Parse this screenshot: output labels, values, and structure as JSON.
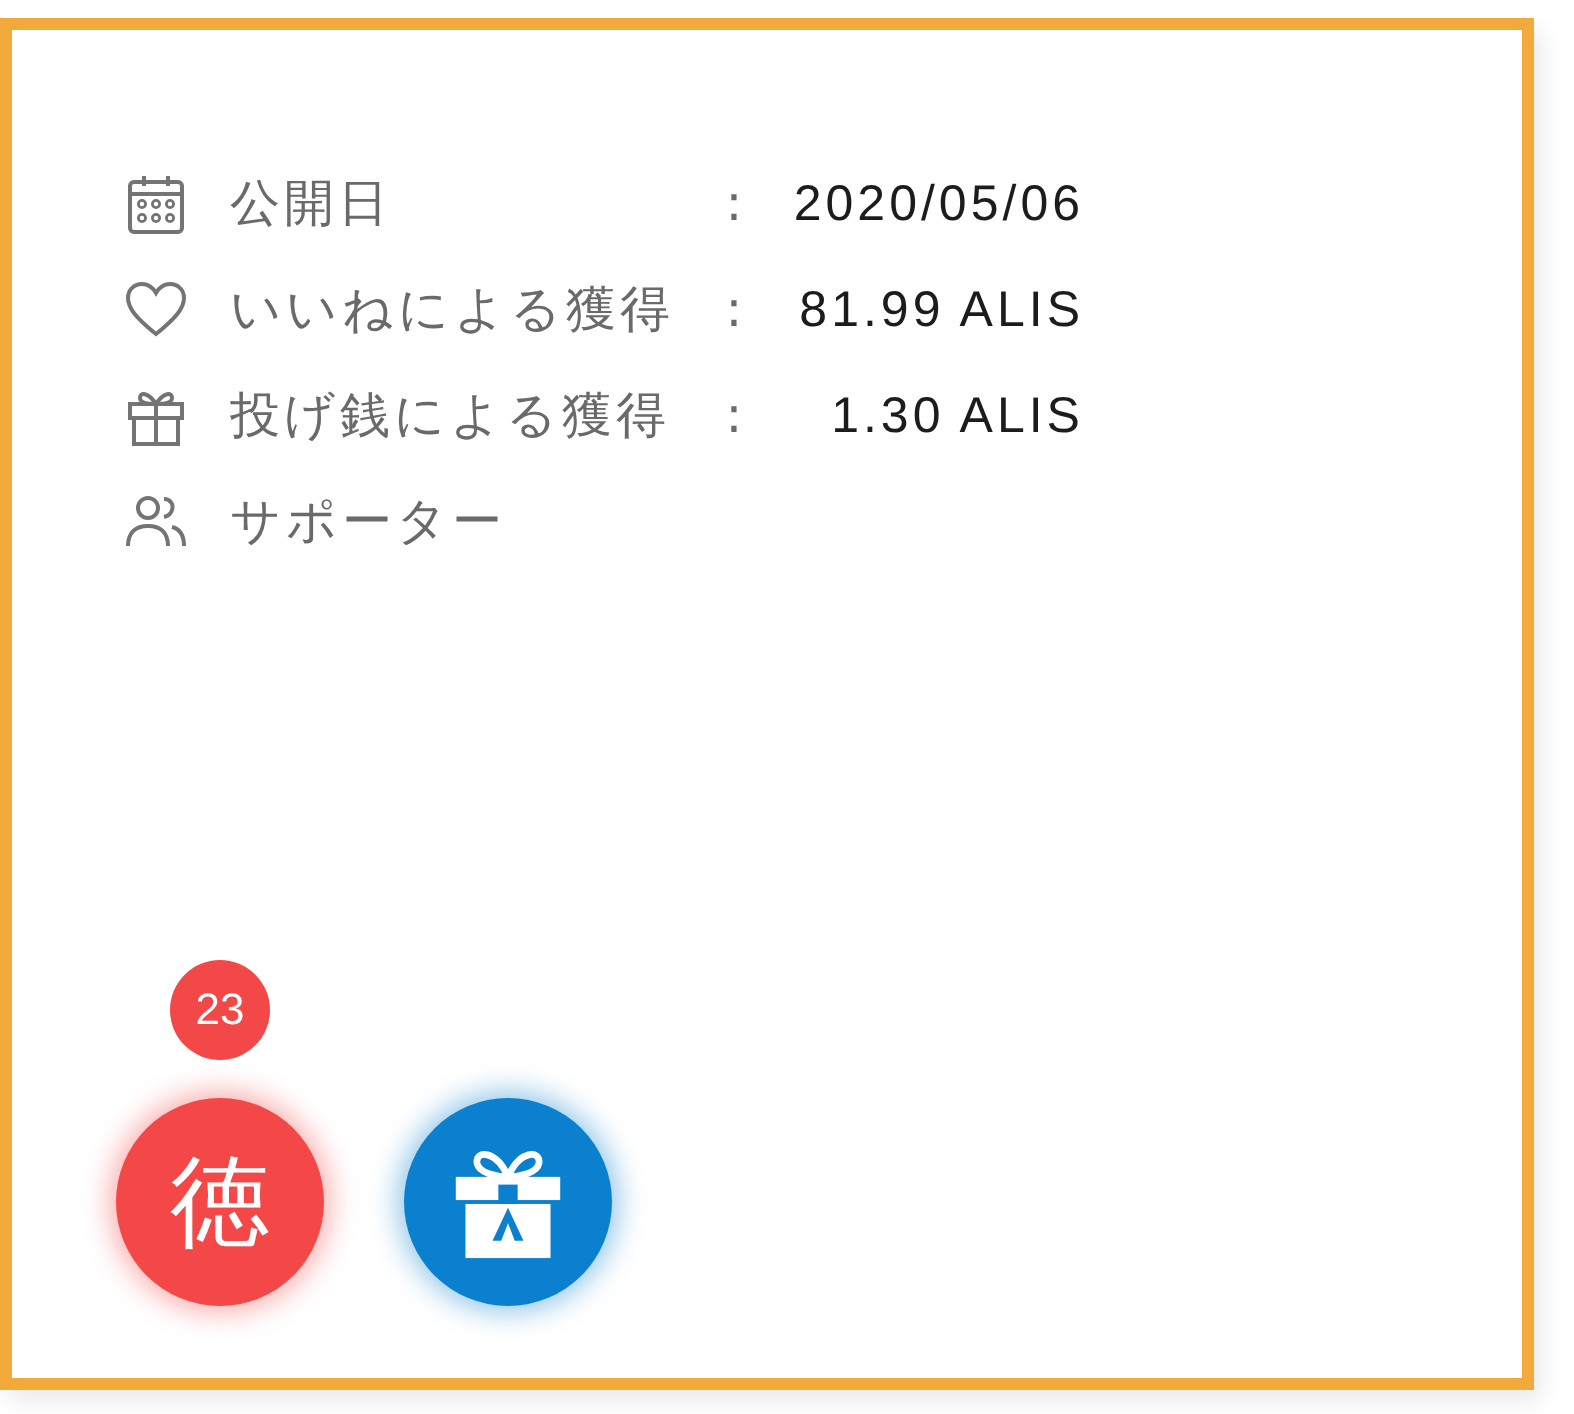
{
  "info": {
    "rows": [
      {
        "kind": "calendar",
        "label": "公開日",
        "separator": ":",
        "value": "2020/05/06"
      },
      {
        "kind": "heart",
        "label": "いいねによる獲得",
        "separator": ":",
        "value": "81.99 ALIS"
      },
      {
        "kind": "gift",
        "label": "投げ銭による獲得",
        "separator": ":",
        "value": "1.30 ALIS"
      },
      {
        "kind": "people",
        "label": "サポーター"
      }
    ]
  },
  "actions": {
    "badge": "23",
    "buttons": [
      {
        "kind": "text",
        "label": "徳"
      },
      {
        "kind": "gift"
      }
    ]
  }
}
